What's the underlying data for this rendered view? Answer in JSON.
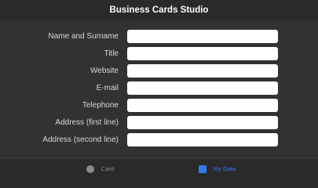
{
  "app": {
    "title": "Business Cards Studio"
  },
  "form": {
    "fields": [
      {
        "label": "Name and Surname",
        "value": ""
      },
      {
        "label": "Title",
        "value": ""
      },
      {
        "label": "Website",
        "value": ""
      },
      {
        "label": "E-mail",
        "value": ""
      },
      {
        "label": "Telephone",
        "value": ""
      },
      {
        "label": "Address (first line)",
        "value": ""
      },
      {
        "label": "Address (second line)",
        "value": ""
      }
    ]
  },
  "tabbar": {
    "tabs": [
      {
        "label": "Card",
        "icon": "circle-icon",
        "active": false
      },
      {
        "label": "My Data",
        "icon": "square-icon",
        "active": true
      }
    ],
    "active_color": "#2f7bf2",
    "inactive_color": "#8a8a8a"
  }
}
